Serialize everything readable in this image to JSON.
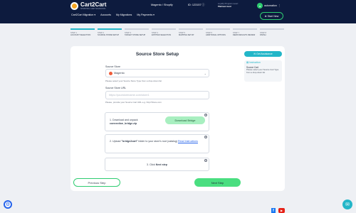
{
  "header": {
    "logo": "Cart2Cart",
    "logo_sub": "SHOPPING CART MIGRATION",
    "nav": [
      "Cart2Cart Migration ▾",
      "Accounts",
      "My Migrations",
      "My Payments ▾"
    ],
    "migration_label": "Magento / Shopify",
    "migration_id_label": "ID: 123157 ⓘ",
    "loyalty_label": "Loyalty Program Level:",
    "loyalty_value": "Platinum level",
    "user_initial": "a",
    "username": "automation",
    "start_button": "Start New"
  },
  "steps": [
    {
      "num": "STEP 1",
      "title": "ACCOUNT SELECTION",
      "active": true
    },
    {
      "num": "STEP 2",
      "title": "SOURCE STORE SETUP",
      "active": true
    },
    {
      "num": "STEP 3",
      "title": "TARGET STORE SETUP",
      "active": false
    },
    {
      "num": "STEP 4",
      "title": "ENTITIES SELECTION",
      "active": false
    },
    {
      "num": "STEP 5",
      "title": "MAPPING SETUP",
      "active": false
    },
    {
      "num": "STEP 6",
      "title": "ADDITIONAL OPTIONS",
      "active": false
    },
    {
      "num": "STEP 7",
      "title": "DEMO RESULTS REVIEW",
      "active": false
    },
    {
      "num": "STEP 8",
      "title": "FINISH",
      "active": false
    }
  ],
  "main": {
    "title": "Source Store Setup",
    "assistance_button": "Get Assistance",
    "instruction_header": "Instruction",
    "instruction_title": "Source Cart",
    "instruction_text": "Please select your Source Cart Type from a drop-down list",
    "source_store_label": "Source Store",
    "source_store_value": "Magento",
    "source_store_hint": "Please select your Source Store Type from a drop-down list",
    "url_label": "Source Store URL",
    "url_placeholder": "https://yourstorename.com/store1",
    "url_hint": "Please, provide your Source Cart URL e.g. http://Store.com",
    "step1_text": "1. Download and unpack",
    "step1_file": "connection_bridge.zip",
    "download_button": "Download Bridge",
    "step2_text_a": "2. Upload ",
    "step2_bold": "\"bridge2cart\"",
    "step2_text_b": " folder to your store's root (catalog) ",
    "step2_link": "Read Instructions",
    "step3_text": "3. Click ",
    "step3_bold": "Next step",
    "prev_button": "Previous Step",
    "next_button": "Next Step"
  }
}
